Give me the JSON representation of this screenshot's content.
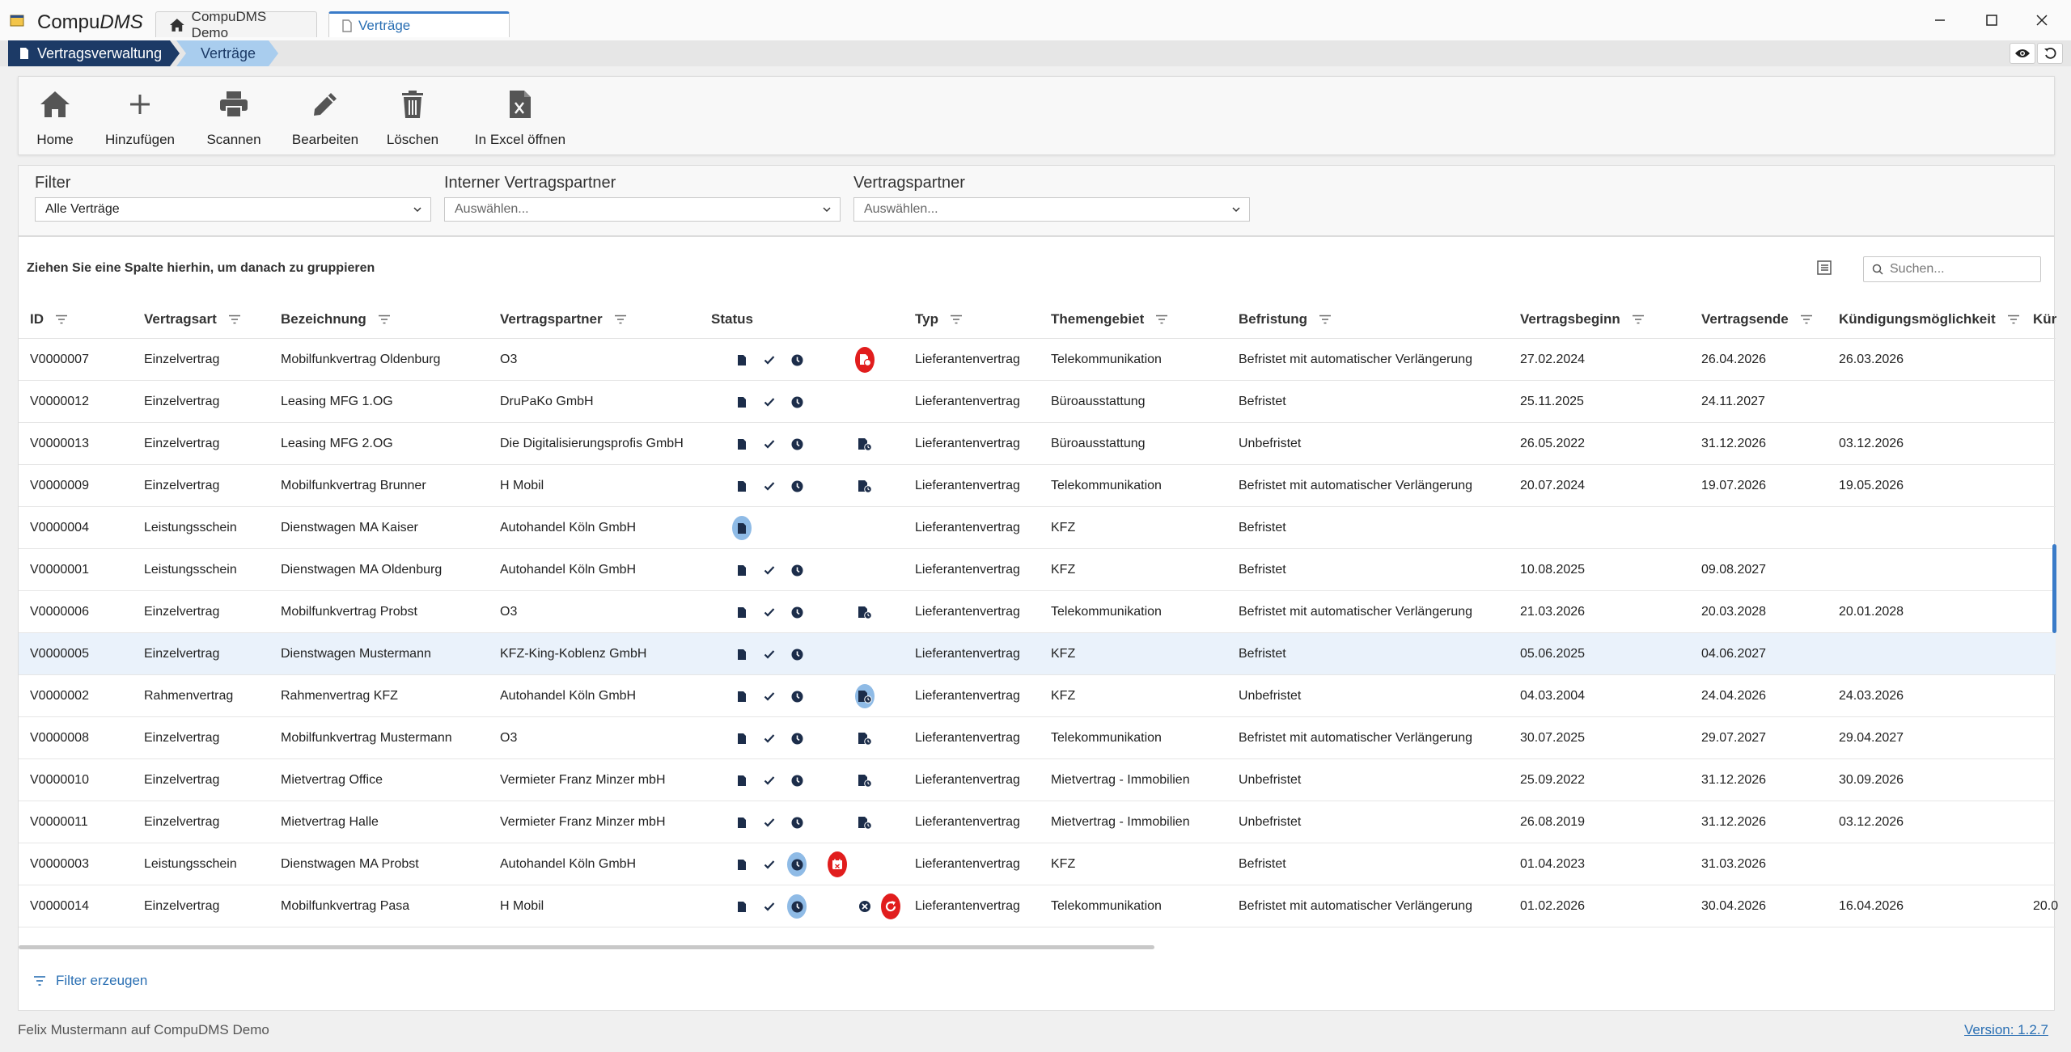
{
  "app": {
    "title_main": "Compu",
    "title_italic": "DMS",
    "tabs": [
      {
        "label": "CompuDMS Demo",
        "icon": "home-icon"
      },
      {
        "label": "Verträge",
        "icon": "document-icon"
      }
    ],
    "window_controls": {
      "minimize": "–",
      "maximize": "☐",
      "close": "✕"
    }
  },
  "breadcrumb": {
    "items": [
      "Vertragsverwaltung",
      "Verträge"
    ]
  },
  "toolbar": {
    "home": "Home",
    "add": "Hinzufügen",
    "scan": "Scannen",
    "edit": "Bearbeiten",
    "delete": "Löschen",
    "excel": "In Excel öffnen"
  },
  "filters": {
    "filter": {
      "label": "Filter",
      "value": "Alle Verträge"
    },
    "internal_partner": {
      "label": "Interner Vertragspartner",
      "placeholder": "Auswählen..."
    },
    "partner": {
      "label": "Vertragspartner",
      "placeholder": "Auswählen..."
    }
  },
  "grid": {
    "group_hint": "Ziehen Sie eine Spalte hierhin, um danach zu gruppieren",
    "search_placeholder": "Suchen...",
    "columns": {
      "id": "ID",
      "art": "Vertragsart",
      "bez": "Bezeichnung",
      "partner": "Vertragspartner",
      "status": "Status",
      "typ": "Typ",
      "thema": "Themengebiet",
      "befr": "Befristung",
      "beginn": "Vertragsbeginn",
      "ende": "Vertragsende",
      "kuend": "Kündigungsmöglichkeit",
      "kuer": "Kür"
    },
    "rows": [
      {
        "id": "V0000007",
        "art": "Einzelvertrag",
        "bez": "Mobilfunkvertrag Oldenburg",
        "partner": "O3",
        "status": {
          "doc": true,
          "check": true,
          "clock": true,
          "extra": "red-doc"
        },
        "typ": "Lieferantenvertrag",
        "thema": "Telekommunikation",
        "befr": "Befristet mit automatischer Verlängerung",
        "beginn": "27.02.2024",
        "ende": "26.04.2026",
        "kuend": "26.03.2026",
        "kuer": ""
      },
      {
        "id": "V0000012",
        "art": "Einzelvertrag",
        "bez": "Leasing MFG 1.OG",
        "partner": "DruPaKo GmbH",
        "status": {
          "doc": true,
          "check": true,
          "clock": true,
          "extra": ""
        },
        "typ": "Lieferantenvertrag",
        "thema": "Büroausstattung",
        "befr": "Befristet",
        "beginn": "25.11.2025",
        "ende": "24.11.2027",
        "kuend": "",
        "kuer": ""
      },
      {
        "id": "V0000013",
        "art": "Einzelvertrag",
        "bez": "Leasing MFG 2.OG",
        "partner": "Die Digitalisierungsprofis GmbH",
        "status": {
          "doc": true,
          "check": true,
          "clock": true,
          "extra": "doc-clock"
        },
        "typ": "Lieferantenvertrag",
        "thema": "Büroausstattung",
        "befr": "Unbefristet",
        "beginn": "26.05.2022",
        "ende": "31.12.2026",
        "kuend": "03.12.2026",
        "kuer": ""
      },
      {
        "id": "V0000009",
        "art": "Einzelvertrag",
        "bez": "Mobilfunkvertrag Brunner",
        "partner": "H Mobil",
        "status": {
          "doc": true,
          "check": true,
          "clock": true,
          "extra": "doc-clock"
        },
        "typ": "Lieferantenvertrag",
        "thema": "Telekommunikation",
        "befr": "Befristet mit automatischer Verlängerung",
        "beginn": "20.07.2024",
        "ende": "19.07.2026",
        "kuend": "19.05.2026",
        "kuer": ""
      },
      {
        "id": "V0000004",
        "art": "Leistungsschein",
        "bez": "Dienstwagen MA Kaiser",
        "partner": "Autohandel Köln GmbH",
        "status": {
          "doc": "hl",
          "check": false,
          "clock": false,
          "extra": ""
        },
        "typ": "Lieferantenvertrag",
        "thema": "KFZ",
        "befr": "Befristet",
        "beginn": "",
        "ende": "",
        "kuend": "",
        "kuer": ""
      },
      {
        "id": "V0000001",
        "art": "Leistungsschein",
        "bez": "Dienstwagen MA Oldenburg",
        "partner": "Autohandel Köln GmbH",
        "status": {
          "doc": true,
          "check": true,
          "clock": true,
          "extra": ""
        },
        "typ": "Lieferantenvertrag",
        "thema": "KFZ",
        "befr": "Befristet",
        "beginn": "10.08.2025",
        "ende": "09.08.2027",
        "kuend": "",
        "kuer": ""
      },
      {
        "id": "V0000006",
        "art": "Einzelvertrag",
        "bez": "Mobilfunkvertrag Probst",
        "partner": "O3",
        "status": {
          "doc": true,
          "check": true,
          "clock": true,
          "extra": "doc-clock"
        },
        "typ": "Lieferantenvertrag",
        "thema": "Telekommunikation",
        "befr": "Befristet mit automatischer Verlängerung",
        "beginn": "21.03.2026",
        "ende": "20.03.2028",
        "kuend": "20.01.2028",
        "kuer": ""
      },
      {
        "id": "V0000005",
        "art": "Einzelvertrag",
        "bez": "Dienstwagen Mustermann",
        "partner": "KFZ-King-Koblenz GmbH",
        "status": {
          "doc": true,
          "check": true,
          "clock": true,
          "extra": ""
        },
        "typ": "Lieferantenvertrag",
        "thema": "KFZ",
        "befr": "Befristet",
        "beginn": "05.06.2025",
        "ende": "04.06.2027",
        "kuend": "",
        "kuer": "",
        "selected": true
      },
      {
        "id": "V0000002",
        "art": "Rahmenvertrag",
        "bez": "Rahmenvertrag KFZ",
        "partner": "Autohandel Köln GmbH",
        "status": {
          "doc": true,
          "check": true,
          "clock": true,
          "extra": "doc-clock-hl"
        },
        "typ": "Lieferantenvertrag",
        "thema": "KFZ",
        "befr": "Unbefristet",
        "beginn": "04.03.2004",
        "ende": "24.04.2026",
        "kuend": "24.03.2026",
        "kuer": ""
      },
      {
        "id": "V0000008",
        "art": "Einzelvertrag",
        "bez": "Mobilfunkvertrag Mustermann",
        "partner": "O3",
        "status": {
          "doc": true,
          "check": true,
          "clock": true,
          "extra": "doc-clock"
        },
        "typ": "Lieferantenvertrag",
        "thema": "Telekommunikation",
        "befr": "Befristet mit automatischer Verlängerung",
        "beginn": "30.07.2025",
        "ende": "29.07.2027",
        "kuend": "29.04.2027",
        "kuer": ""
      },
      {
        "id": "V0000010",
        "art": "Einzelvertrag",
        "bez": "Mietvertrag Office",
        "partner": "Vermieter Franz Minzer mbH",
        "status": {
          "doc": true,
          "check": true,
          "clock": true,
          "extra": "doc-clock"
        },
        "typ": "Lieferantenvertrag",
        "thema": "Mietvertrag - Immobilien",
        "befr": "Unbefristet",
        "beginn": "25.09.2022",
        "ende": "31.12.2026",
        "kuend": "30.09.2026",
        "kuer": ""
      },
      {
        "id": "V0000011",
        "art": "Einzelvertrag",
        "bez": "Mietvertrag Halle",
        "partner": "Vermieter Franz Minzer mbH",
        "status": {
          "doc": true,
          "check": true,
          "clock": true,
          "extra": "doc-clock"
        },
        "typ": "Lieferantenvertrag",
        "thema": "Mietvertrag - Immobilien",
        "befr": "Unbefristet",
        "beginn": "26.08.2019",
        "ende": "31.12.2026",
        "kuend": "03.12.2026",
        "kuer": ""
      },
      {
        "id": "V0000003",
        "art": "Leistungsschein",
        "bez": "Dienstwagen MA Probst",
        "partner": "Autohandel Köln GmbH",
        "status": {
          "doc": true,
          "check": true,
          "clock": "hl",
          "extra": "red-calendar"
        },
        "typ": "Lieferantenvertrag",
        "thema": "KFZ",
        "befr": "Befristet",
        "beginn": "01.04.2023",
        "ende": "31.03.2026",
        "kuend": "",
        "kuer": ""
      },
      {
        "id": "V0000014",
        "art": "Einzelvertrag",
        "bez": "Mobilfunkvertrag Pasa",
        "partner": "H Mobil",
        "status": {
          "doc": true,
          "check": true,
          "clock": "hl",
          "extra": "x-and-red-renew"
        },
        "typ": "Lieferantenvertrag",
        "thema": "Telekommunikation",
        "befr": "Befristet mit automatischer Verlängerung",
        "beginn": "01.02.2026",
        "ende": "30.04.2026",
        "kuend": "16.04.2026",
        "kuer": "20.0"
      }
    ],
    "filter_create": "Filter erzeugen"
  },
  "statusbar": {
    "user": "Felix Mustermann auf CompuDMS Demo",
    "version": "Version: 1.2.7"
  },
  "colors": {
    "accent": "#2a6fb3",
    "breadcrumb_dark": "#1c3a66",
    "breadcrumb_light": "#a9cdee",
    "highlight": "#8fbbe6",
    "alert": "#e11d1d"
  }
}
